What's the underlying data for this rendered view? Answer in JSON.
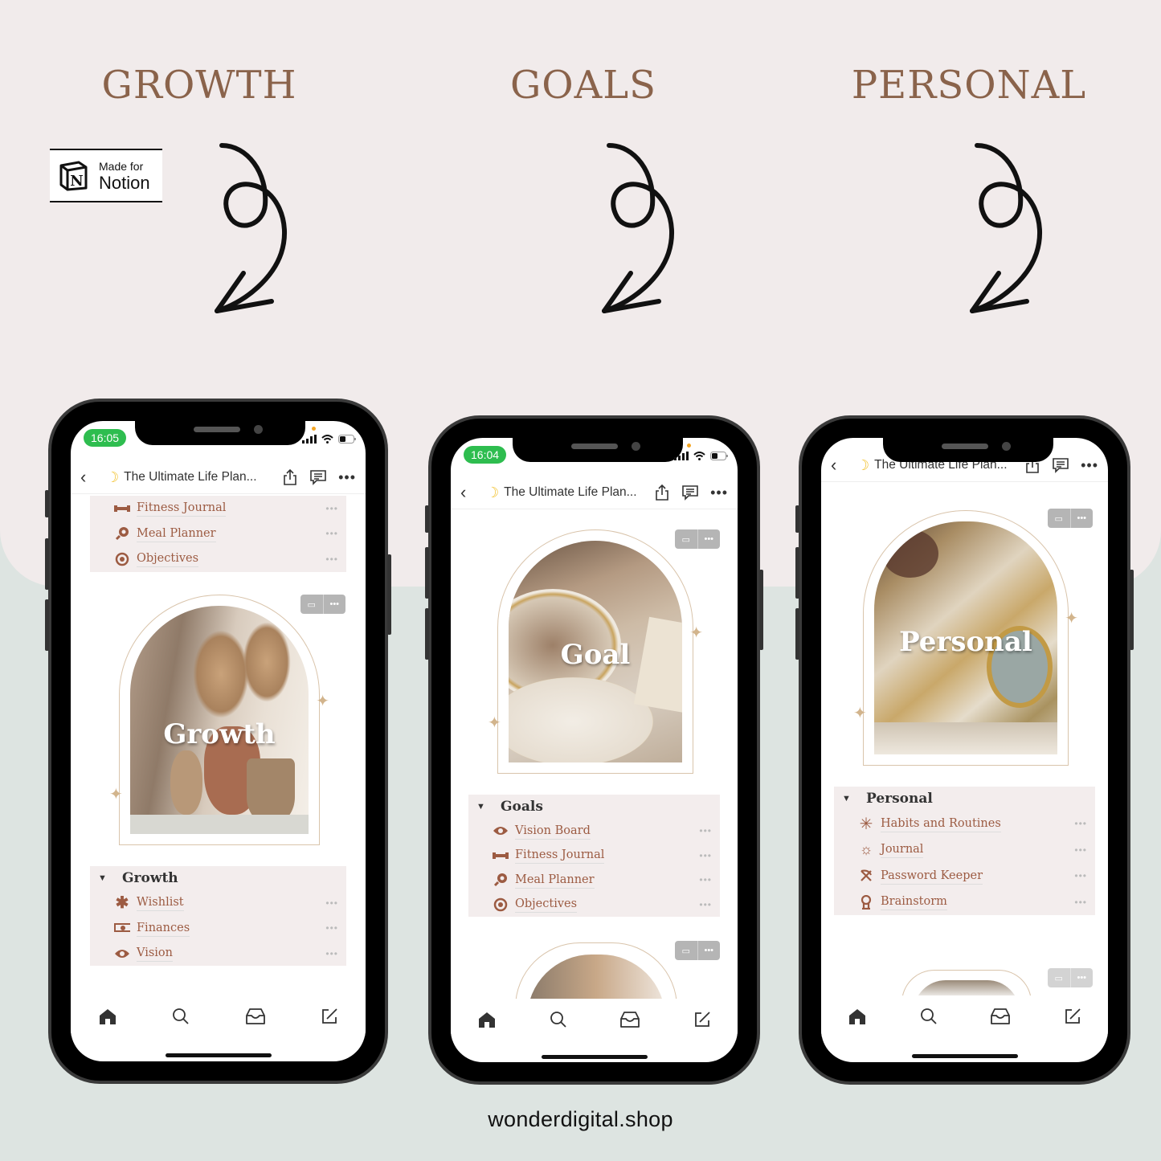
{
  "headings": [
    "GROWTH",
    "GOALS",
    "PERSONAL"
  ],
  "badge": {
    "line1": "Made for",
    "line2": "Notion",
    "logo_letter": "N"
  },
  "footer": "wonderdigital.shop",
  "colors": {
    "heading": "#8a634b",
    "link": "#9c5b42",
    "status_green": "#2ebd4f",
    "top_bg": "#f1ebeb",
    "bottom_bg": "#dde4e1"
  },
  "phones": [
    {
      "time": "16:05",
      "page_title": "The Ultimate Life Plan...",
      "top_list": [
        {
          "icon": "dumbbell-icon",
          "label": "Fitness Journal"
        },
        {
          "icon": "meal-icon",
          "label": "Meal Planner"
        },
        {
          "icon": "target-icon",
          "label": "Objectives"
        }
      ],
      "cover_title": "Growth",
      "group": {
        "name": "Growth",
        "items": [
          {
            "icon": "asterisk-icon",
            "label": "Wishlist"
          },
          {
            "icon": "money-icon",
            "label": "Finances"
          },
          {
            "icon": "eye-icon",
            "label": "Vision"
          }
        ]
      }
    },
    {
      "time": "16:04",
      "page_title": "The Ultimate Life Plan...",
      "cover_title": "Goal",
      "group": {
        "name": "Goals",
        "items": [
          {
            "icon": "eye-icon",
            "label": "Vision Board"
          },
          {
            "icon": "dumbbell-icon",
            "label": "Fitness Journal"
          },
          {
            "icon": "meal-icon",
            "label": "Meal Planner"
          },
          {
            "icon": "target-icon",
            "label": "Objectives"
          }
        ]
      }
    },
    {
      "page_title": "The Ultimate Life Plan...",
      "cover_title": "Personal",
      "group": {
        "name": "Personal",
        "items": [
          {
            "icon": "asterisk-thin-icon",
            "label": "Habits and Routines"
          },
          {
            "icon": "sun-icon",
            "label": "Journal"
          },
          {
            "icon": "bow-arrow-icon",
            "label": "Password Keeper"
          },
          {
            "icon": "brain-icon",
            "label": "Brainstorm"
          }
        ]
      }
    }
  ],
  "tabbar": [
    "home-icon",
    "search-icon",
    "inbox-icon",
    "compose-icon"
  ],
  "row_more": "•••"
}
